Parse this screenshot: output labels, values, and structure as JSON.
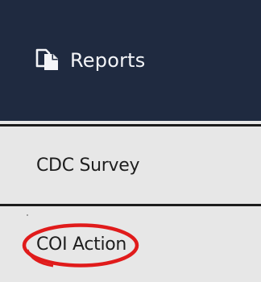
{
  "header": {
    "icon": "copy-documents-icon",
    "label": "Reports",
    "background_color": "#1f2a40"
  },
  "menu": {
    "items": [
      {
        "label": "CDC Survey"
      },
      {
        "label": "COI Action",
        "highlighted": true
      }
    ],
    "background_color": "#e7e7e7"
  },
  "annotation": {
    "shape": "ellipse",
    "color": "#e01b1b",
    "target": "COI Action"
  }
}
